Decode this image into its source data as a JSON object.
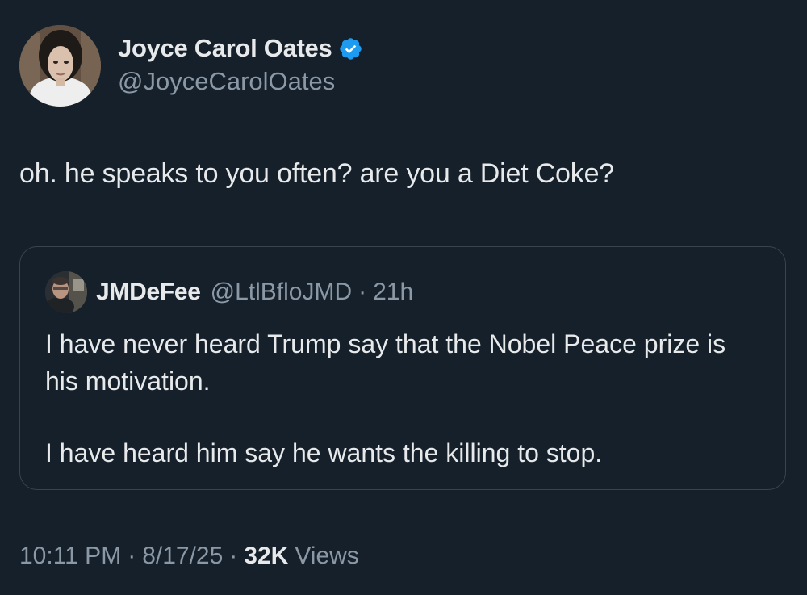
{
  "author": {
    "name": "Joyce Carol Oates",
    "handle": "@JoyceCarolOates",
    "verified": true,
    "verified_color": "#1d9bf0"
  },
  "tweet": {
    "text": "oh. he speaks to you often? are you a Diet Coke?"
  },
  "quoted": {
    "name": "JMDeFee",
    "handle": "@LtlBfloJMD",
    "separator": "·",
    "time": "21h",
    "paragraphs": [
      "I have never heard Trump say that the Nobel Peace prize is his motivation.",
      "I have heard him say he wants the killing to stop."
    ]
  },
  "meta": {
    "time": "10:11 PM",
    "separator": "·",
    "date": "8/17/25",
    "views_count": "32K",
    "views_label": "Views"
  },
  "theme": {
    "background": "#15202b",
    "text_primary": "#e7e9ea",
    "text_secondary": "#8b98a5",
    "border": "#38444d"
  }
}
